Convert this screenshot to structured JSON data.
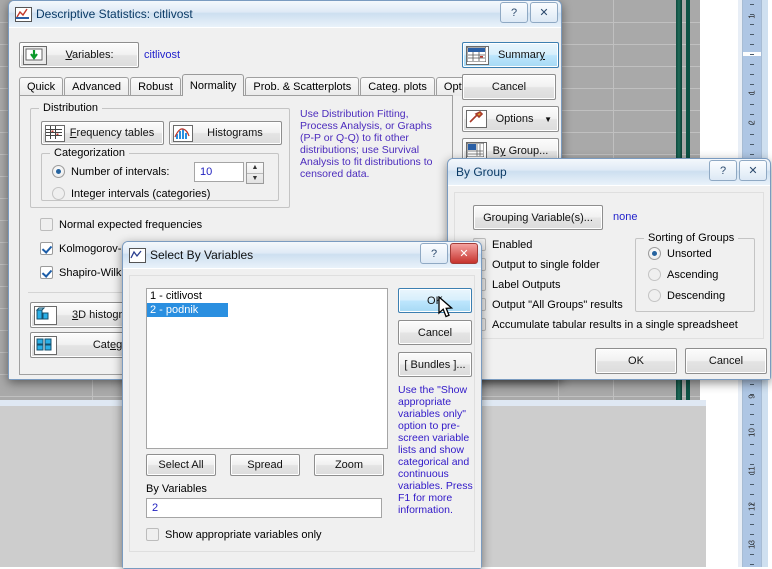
{
  "background": {
    "ruler_numbers": [
      "1",
      "1",
      "2",
      "9",
      "10",
      "11",
      "12",
      "13"
    ]
  },
  "main_dialog": {
    "title": "Descriptive Statistics: citlivost",
    "icon": "chart-icon",
    "titlebar_buttons": [
      {
        "name": "help-button",
        "glyph": "?"
      },
      {
        "name": "close-button",
        "glyph": "✕"
      }
    ],
    "variables_button": "Variables:",
    "variables_value": "citlivost",
    "tabs": [
      {
        "label": "Quick",
        "selected": false
      },
      {
        "label": "Advanced",
        "selected": false
      },
      {
        "label": "Robust",
        "selected": false
      },
      {
        "label": "Normality",
        "selected": true
      },
      {
        "label": "Prob. & Scatterplots",
        "selected": false
      },
      {
        "label": "Categ. plots",
        "selected": false
      },
      {
        "label": "Options",
        "selected": false
      }
    ],
    "distribution": {
      "caption": "Distribution",
      "frequency_tables_button": "Frequency tables",
      "histograms_button": "Histograms",
      "categorization": {
        "caption": "Categorization",
        "number_of_intervals_label": "Number of intervals:",
        "number_of_intervals_value": "10",
        "number_of_intervals_selected": true,
        "integer_intervals_label": "Integer intervals (categories)",
        "integer_intervals_selected": false
      }
    },
    "checkboxes": [
      {
        "label": "Normal expected frequencies",
        "checked": false
      },
      {
        "label": "Kolmogorov-Smirnov",
        "checked": true
      },
      {
        "label": "Shapiro-Wilk's T",
        "checked": true
      }
    ],
    "bottom_buttons": [
      {
        "label": "3D histograms",
        "icon": "3d-histogram-icon"
      },
      {
        "label": "Categ",
        "icon": "categorized-histogram-icon"
      }
    ],
    "side_note": "Use Distribution Fitting, Process Analysis, or Graphs (P-P or Q-Q) to fit other distributions; use Survival Analysis to fit distributions to censored data.",
    "right_buttons": [
      {
        "label": "Summary",
        "icon": "summary-icon",
        "default": true
      },
      {
        "label": "Cancel",
        "icon": ""
      },
      {
        "label": "Options",
        "icon": "options-icon",
        "dropdown": true
      },
      {
        "label": "By Group...",
        "icon": "by-group-icon"
      }
    ]
  },
  "by_group_dialog": {
    "title": "By Group",
    "titlebar_buttons": [
      {
        "name": "help-button",
        "glyph": "?"
      },
      {
        "name": "close-button",
        "glyph": "✕"
      }
    ],
    "grouping_variables_button": "Grouping Variable(s)...",
    "grouping_variables_value": "none",
    "checkboxes": [
      {
        "label": "Enabled",
        "checked": false
      },
      {
        "label": "Output to single folder",
        "checked": false
      },
      {
        "label": "Label Outputs",
        "checked": false
      },
      {
        "label": "Output \"All Groups\" results",
        "checked": false
      },
      {
        "label": "Accumulate tabular results in a single spreadsheet",
        "checked": false
      }
    ],
    "sorting": {
      "caption": "Sorting of Groups",
      "options": [
        {
          "label": "Unsorted",
          "selected": true
        },
        {
          "label": "Ascending",
          "selected": false
        },
        {
          "label": "Descending",
          "selected": false
        }
      ]
    },
    "ok_button": "OK",
    "cancel_button": "Cancel"
  },
  "select_dialog": {
    "title": "Select By Variables",
    "icon": "chart-icon",
    "titlebar_buttons": [
      {
        "name": "help-button",
        "glyph": "?"
      },
      {
        "name": "close-button",
        "glyph": "✕"
      }
    ],
    "variables": [
      {
        "label": "1 - citlivost",
        "selected": false
      },
      {
        "label": "2 - podnik",
        "selected": true
      }
    ],
    "ok_button": "OK",
    "cancel_button": "Cancel",
    "bundles_button": "[ Bundles ]...",
    "help_text": "Use the \"Show appropriate variables only\" option to pre-screen variable lists and show categorical and continuous variables. Press F1 for more information.",
    "select_all_button": "Select All",
    "spread_button": "Spread",
    "zoom_button": "Zoom",
    "by_variables_label": "By Variables",
    "by_variables_value": "2",
    "show_appropriate_label": "Show appropriate variables only",
    "show_appropriate_checked": false
  }
}
